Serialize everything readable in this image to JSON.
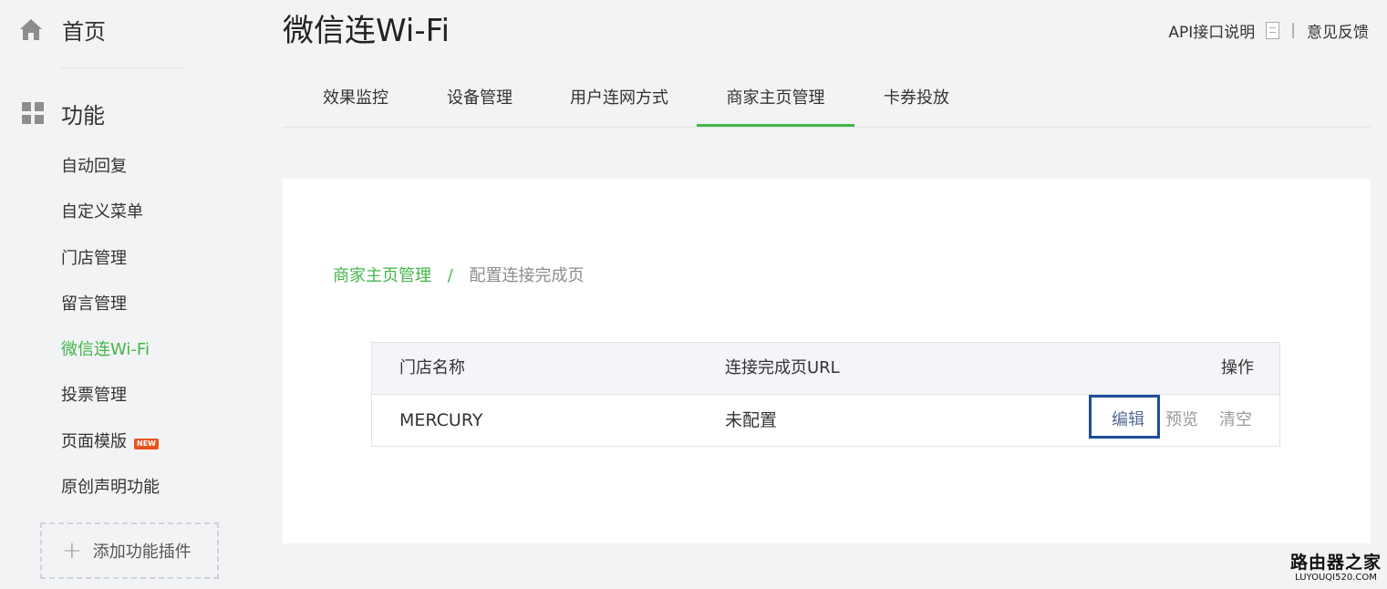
{
  "sidebar": {
    "home_label": "首页",
    "function_label": "功能",
    "items": [
      {
        "label": "自动回复"
      },
      {
        "label": "自定义菜单"
      },
      {
        "label": "门店管理"
      },
      {
        "label": "留言管理"
      },
      {
        "label": "微信连Wi-Fi",
        "active": true
      },
      {
        "label": "投票管理"
      },
      {
        "label": "页面模版",
        "badge": "NEW"
      },
      {
        "label": "原创声明功能"
      }
    ],
    "add_plugin_label": "添加功能插件",
    "active_color": "#44b549"
  },
  "header": {
    "title": "微信连Wi-Fi",
    "api_doc_label": "API接口说明",
    "separator": "|",
    "feedback_label": "意见反馈"
  },
  "tabs": [
    {
      "label": "效果监控"
    },
    {
      "label": "设备管理"
    },
    {
      "label": "用户连网方式"
    },
    {
      "label": "商家主页管理",
      "active": true
    },
    {
      "label": "卡券投放"
    }
  ],
  "breadcrumb": {
    "parent": "商家主页管理",
    "separator": "/",
    "current": "配置连接完成页"
  },
  "table": {
    "headers": {
      "store": "门店名称",
      "url": "连接完成页URL",
      "ops": "操作"
    },
    "rows": [
      {
        "store": "MERCURY",
        "url": "未配置",
        "edit": "编辑",
        "preview": "预览",
        "clear": "清空"
      }
    ]
  },
  "watermark": {
    "cn": "路由器之家",
    "en": "LUYOUQI520.COM"
  },
  "colors": {
    "accent": "#44b549",
    "link": "#576b95",
    "highlight": "#1f4e9a"
  }
}
